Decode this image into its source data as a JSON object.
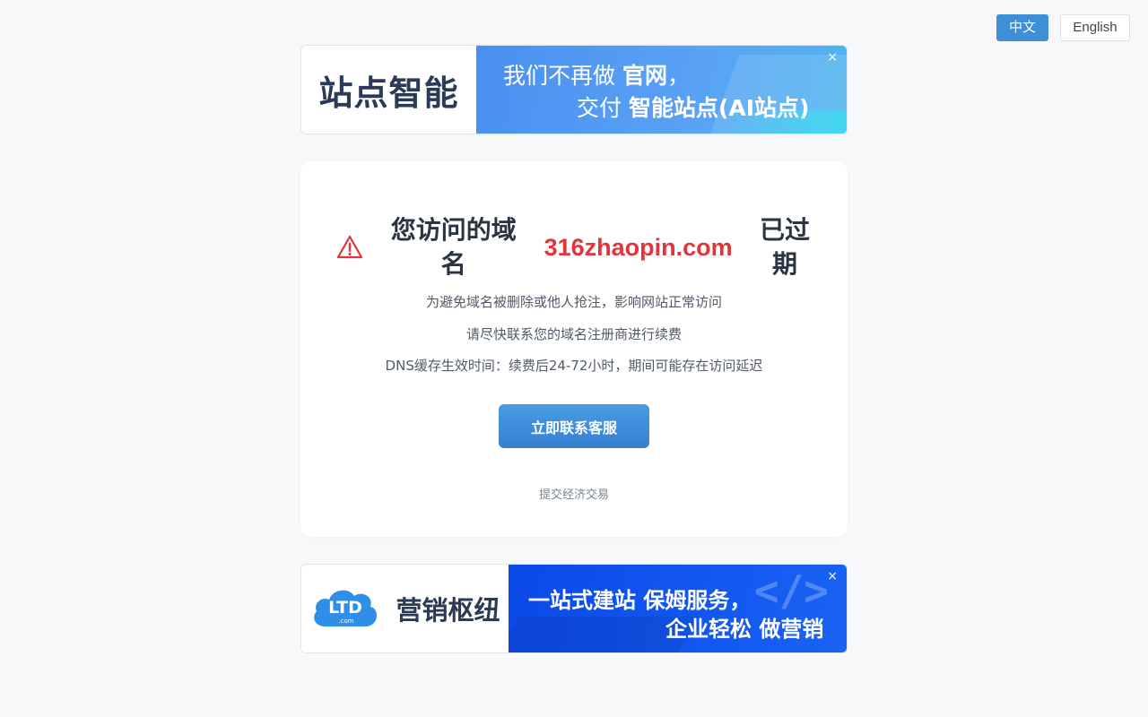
{
  "language_switch": {
    "chinese_label": "中文",
    "english_label": "English"
  },
  "top_banner": {
    "brand": "站点智能",
    "line1_prefix": "我们不再做 ",
    "line1_bold": "官网",
    "line1_suffix": "，",
    "line2_prefix": "交付 ",
    "line2_bold": "智能站点(AI站点)",
    "close_label": "×"
  },
  "notice": {
    "headline_before": "您访问的域名",
    "domain": "316zhaopin.com",
    "headline_after": "已过期",
    "line1": "为避免域名被删除或他人抢注，影响网站正常访问",
    "line2": "请尽快联系您的域名注册商进行续费",
    "line3": "DNS缓存生效时间：续费后24-72小时，期间可能存在访问延迟",
    "cta_label": "立即联系客服",
    "trade_link": "提交经济交易",
    "accent_color": "#e0353a",
    "icon": "warning-triangle-icon"
  },
  "bottom_banner": {
    "logo_text": "LTD",
    "logo_subtext": ".com",
    "brand": "营销枢纽",
    "line1_prefix": "一站式建站 ",
    "line1_bold": "保姆服务",
    "line1_suffix": "，",
    "line2_prefix": "企业轻松 ",
    "line2_bold": "做营销",
    "code_glyph": "</>",
    "close_label": "×"
  }
}
